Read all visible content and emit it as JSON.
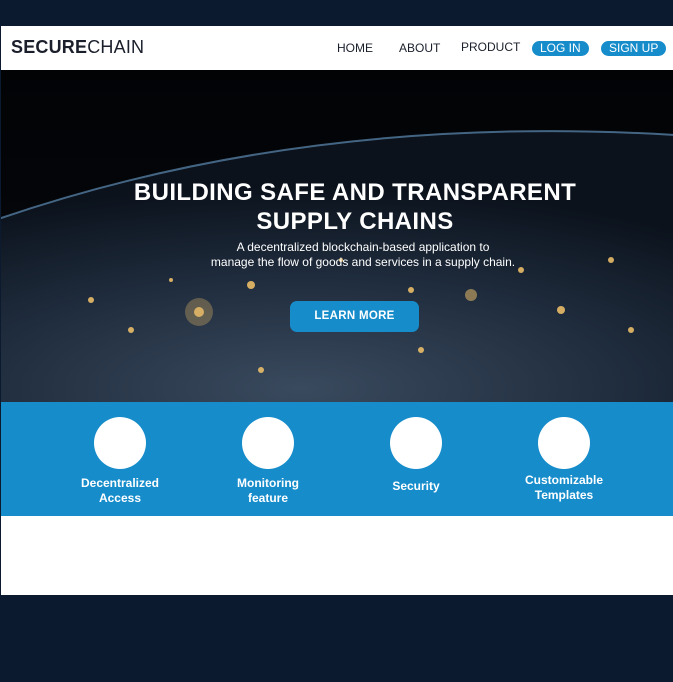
{
  "nav": {
    "logo_bold": "SECURE",
    "logo_light": "CHAIN",
    "links": [
      "HOME",
      "ABOUT",
      "PRODUCT"
    ],
    "login": "LOG IN",
    "signup": "SIGN UP"
  },
  "hero": {
    "title_line1": "BUILDING SAFE AND TRANSPARENT",
    "title_line2": "SUPPLY CHAINS",
    "sub_line1": "A decentralized blockchain-based application to",
    "sub_line2": "manage the flow of goods and services in a supply chain.",
    "cta": "LEARN MORE"
  },
  "features": [
    {
      "line1": "Decentralized",
      "line2": "Access"
    },
    {
      "line1": "Monitoring",
      "line2": "feature"
    },
    {
      "line1": "Security",
      "line2": ""
    },
    {
      "line1": "Customizable",
      "line2": "Templates"
    }
  ],
  "colors": {
    "accent": "#168ccb",
    "dark": "#0c1a30",
    "white": "#ffffff"
  }
}
